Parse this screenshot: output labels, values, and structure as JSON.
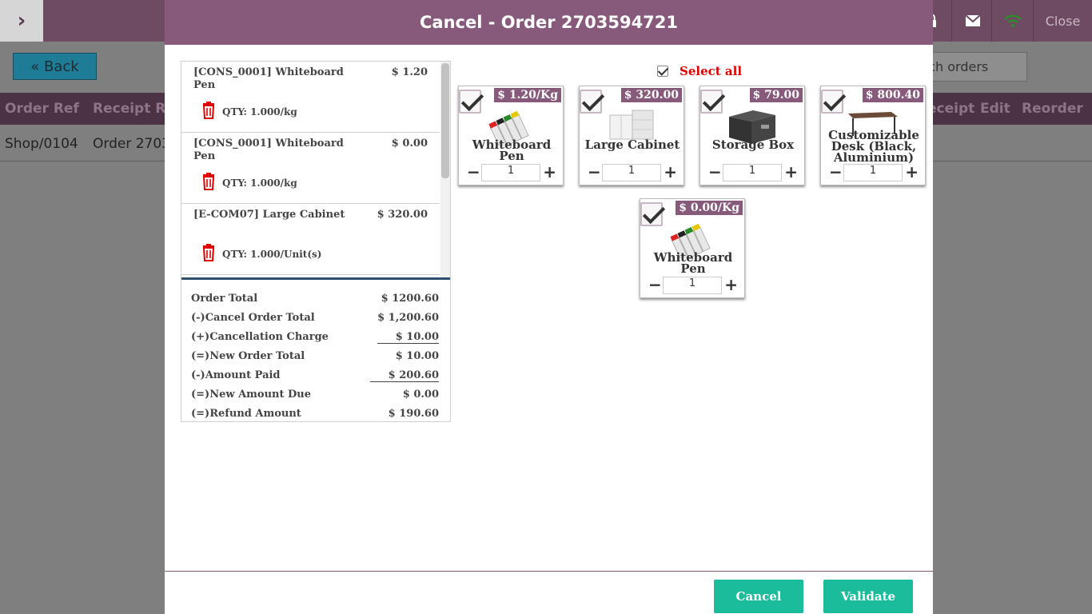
{
  "background": {
    "close_label": "Close",
    "back_label": "« Back",
    "search_text": "rch orders",
    "columns": [
      "Order Ref",
      "Receipt Re",
      "eceipt",
      "Edit",
      "Reorder"
    ],
    "row": [
      "Shop/0104",
      "Order 2703"
    ]
  },
  "modal": {
    "title": "Cancel - Order 2703594721",
    "lines": [
      {
        "name": "[CONS_0001] Whiteboard Pen",
        "price": "$ 1.20",
        "qty": "QTY: 1.000/kg"
      },
      {
        "name": "[CONS_0001] Whiteboard Pen",
        "price": "$ 0.00",
        "qty": "QTY: 1.000/kg"
      },
      {
        "name": "[E-COM07] Large Cabinet",
        "price": "$ 320.00",
        "qty": "QTY: 1.000/Unit(s)"
      }
    ],
    "totals": [
      {
        "label": "Order Total",
        "value": "$ 1200.60"
      },
      {
        "label": "(-)Cancel Order Total",
        "value": "$ 1,200.60"
      },
      {
        "label": "(+)Cancellation Charge",
        "value": "$ 10.00"
      },
      {
        "label": "(=)New Order Total",
        "value": "$ 10.00"
      },
      {
        "label": "(-)Amount Paid",
        "value": "$ 200.60"
      },
      {
        "label": "(=)New Amount Due",
        "value": "$ 0.00"
      },
      {
        "label": "(=)Refund Amount",
        "value": "$ 190.60"
      }
    ],
    "select_all_label": "Select all",
    "products": [
      {
        "price": "$ 1.20/Kg",
        "name": "Whiteboard Pen",
        "qty": "1",
        "image": "whiteboard-pen-image"
      },
      {
        "price": "$ 320.00",
        "name": "Large Cabinet",
        "qty": "1",
        "image": "cabinet-image"
      },
      {
        "price": "$ 79.00",
        "name": "Storage Box",
        "qty": "1",
        "image": "storage-box-image"
      },
      {
        "price": "$ 800.40",
        "name": "Customizable Desk (Black, Aluminium)",
        "qty": "1",
        "image": "desk-image"
      },
      {
        "price": "$ 0.00/Kg",
        "name": "Whiteboard Pen",
        "qty": "1",
        "image": "whiteboard-pen-image"
      }
    ],
    "cancel_label": "Cancel",
    "validate_label": "Validate"
  },
  "colors": {
    "header": "#875a7b",
    "button": "#1abc9c",
    "select_all": "#e00000",
    "delete_icon": "#e00000"
  }
}
